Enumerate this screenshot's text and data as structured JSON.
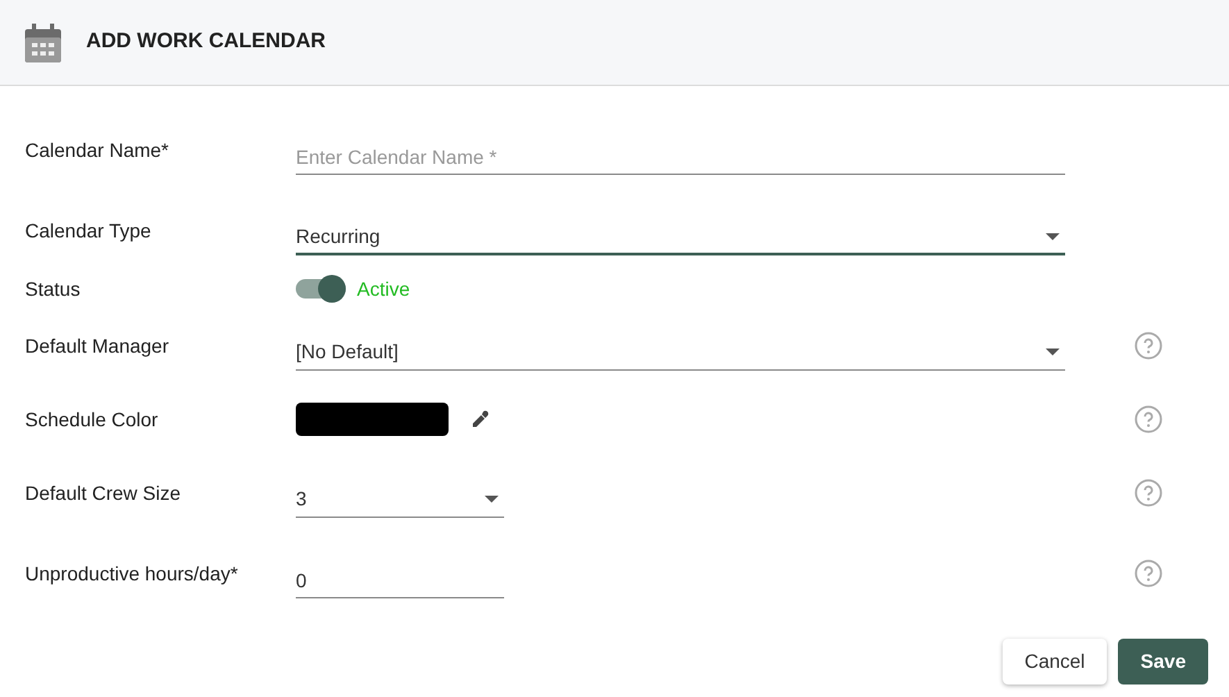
{
  "header": {
    "title": "ADD WORK CALENDAR"
  },
  "fields": [
    {
      "kind": "text",
      "label": "Calendar Name*",
      "placeholder": "Enter Calendar Name *",
      "help": false,
      "focused": false
    },
    {
      "kind": "select",
      "label": "Calendar Type",
      "value": "Recurring",
      "help": false,
      "focused": true
    },
    {
      "kind": "toggle",
      "label": "Status",
      "on": true,
      "value": "Active",
      "help": false
    },
    {
      "kind": "select",
      "label": "Default Manager",
      "value": "[No Default]",
      "help": true,
      "focused": false
    },
    {
      "kind": "color",
      "label": "Schedule Color",
      "color": "#000000",
      "help": true
    },
    {
      "kind": "select-short",
      "label": "Default Crew Size",
      "value": "3",
      "help": true,
      "focused": false
    },
    {
      "kind": "text-short",
      "label": "Unproductive hours/day*",
      "value": "0",
      "help": true,
      "focused": false
    }
  ],
  "buttons": [
    {
      "label": "Cancel",
      "primary": false
    },
    {
      "label": "Save",
      "primary": true
    }
  ]
}
